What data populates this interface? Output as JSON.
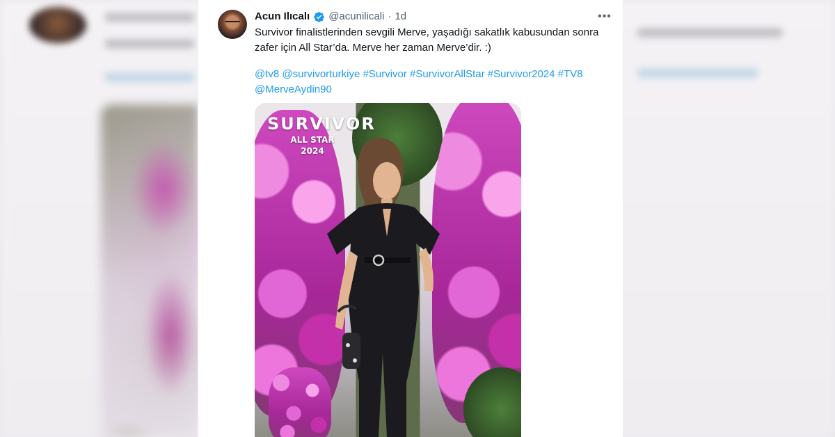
{
  "tweet": {
    "author_name": "Acun Ilıcalı",
    "handle": "@acunilicali",
    "separator": "·",
    "timestamp": "1d",
    "more_label": "•••",
    "text": "Survivor finalistlerinden sevgili Merve, yaşadığı sakatlık kabusundan sonra zafer için All Star’da. Merve her zaman Merve’dir. :)",
    "links": [
      "@tv8",
      "@survivorturkiye",
      "#Survivor",
      "#SurvivorAllStar",
      "#Survivor2024",
      "#TV8",
      "@MerveAydin90"
    ]
  },
  "media": {
    "logo_main": "SURVIVOR",
    "logo_sub_1": "ALL STAR",
    "logo_sub_2": "2024"
  },
  "icons": {
    "verified": "verified-badge-icon",
    "more": "more-options-icon"
  },
  "colors": {
    "link": "#1d9bf0",
    "verified": "#1d9bf0",
    "text": "#0f1419",
    "muted": "#536471"
  }
}
